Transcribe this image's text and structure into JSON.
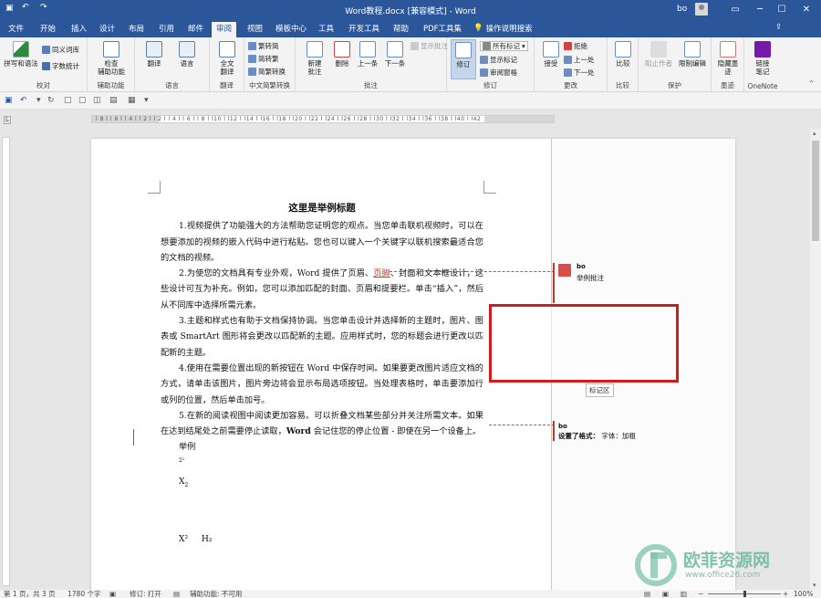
{
  "window": {
    "title": "Word教程.docx [兼容模式] - Word",
    "user": "bo"
  },
  "tabs": [
    "文件",
    "开始",
    "插入",
    "设计",
    "布局",
    "引用",
    "邮件",
    "审阅",
    "视图",
    "模板中心",
    "工具",
    "开发工具",
    "帮助",
    "PDF工具集",
    "操作说明搜索"
  ],
  "active_tab": "审阅",
  "ribbon": {
    "proofing": {
      "spell": "拼写和语法",
      "thesaurus": "同义词库",
      "wordcount": "字数统计",
      "label": "校对"
    },
    "accessibility": {
      "check": "检查",
      "check2": "辅助功能",
      "label": "辅助功能"
    },
    "language": {
      "translate": "翻译",
      "language": "语言",
      "label": "语言"
    },
    "fulltranslate": {
      "btn1": "全文",
      "btn2": "翻译",
      "label": "翻译"
    },
    "chinese": {
      "t2s": "繁转简",
      "s2t": "简转繁",
      "convert": "简繁转换",
      "label": "中文简繁转换"
    },
    "comments": {
      "new1": "新建",
      "new2": "批注",
      "delete": "删除",
      "prev": "上一条",
      "next": "下一条",
      "show": "显示批注",
      "label": "批注"
    },
    "tracking": {
      "track": "修订",
      "allmarkup": "所有标记",
      "showmarkup": "显示标记",
      "pane": "审阅窗格",
      "label": "修订"
    },
    "changes": {
      "accept": "接受",
      "reject": "拒绝",
      "prev": "上一处",
      "next": "下一处",
      "label": "更改"
    },
    "compare": {
      "btn": "比较",
      "label": "比较"
    },
    "protect": {
      "block": "阻止作者",
      "restrict": "限制编辑",
      "label": "保护"
    },
    "ink": {
      "hide1": "隐藏墨",
      "hide2": "迹",
      "label": "墨迹"
    },
    "onenote": {
      "link1": "链接",
      "link2": "笔记",
      "label": "OneNote"
    }
  },
  "ruler_text": "l 8 l  l 6 l  l 4 l  l 2 l     l 2 l  l 4 l  l 6 l  l 8 l  l10 l  l12 l  l14 l  l16 l  l18 l  l20 l  l22 l  l24 l  l26 l  l28 l  l30 l  l32 l  l34 l  l36 l  l38 l  l40 l  l42",
  "document": {
    "title": "这里是举例标题",
    "p1": "1.视频提供了功能强大的方法帮助您证明您的观点。当您单击联机视频时，可以在想要添加的视频的嵌入代码中进行粘贴。您也可以键入一个关键字以联机搜索最适合您的文档的视频。",
    "p2_before": "2.为使您的文档具有专业外观，Word 提供了页眉、",
    "p2_marked": "页脚",
    "p2_after": "、封面和文本框设计，这些设计可互为补充。例如，您可以添加匹配的封面、页眉和提要栏。单击“插入”，然后从不同库中选择所需元素。",
    "p3": "3.主题和样式也有助于文档保持协调。当您单击设计并选择新的主题时，图片、图表或 SmartArt 图形将会更改以匹配新的主题。应用样式时，您的标题会进行更改以匹配新的主题。",
    "p4": "4.使用在需要位置出现的新按钮在 Word 中保存时间。如果要更改图片适应文档的方式，请单击该图片，图片旁边将会显示布局选项按钮。当处理表格时，单击要添加行或列的位置，然后单击加号。",
    "p5_a": "5.在新的阅读视图中阅读更加容易。可以折叠文档某些部分并关注所需文本。如果在达到结尾处之前需要停止读取，",
    "p5_bold": "Word",
    "p5_b": " 会记住您的停止位置 - 即使在另一个设备上。",
    "example": "举例",
    "small1": "2²",
    "x2": "X",
    "x2sub": "2",
    "x2sup": "X²",
    "h2": "H₂"
  },
  "comments": {
    "c1_author": "bo",
    "c1_text": "举例批注",
    "c2_author": "bo",
    "c2_text_bold": "设置了格式：",
    "c2_text": "字体：加粗",
    "tip": "标记区"
  },
  "status": {
    "page": "第 1 页，共 3 页",
    "words": "1780 个字",
    "track": "修订: 打开",
    "accessibility": "辅助功能: 不可用",
    "zoom": "100%"
  },
  "watermark": {
    "name": "欧菲资源网",
    "url": "www.office26.com"
  }
}
